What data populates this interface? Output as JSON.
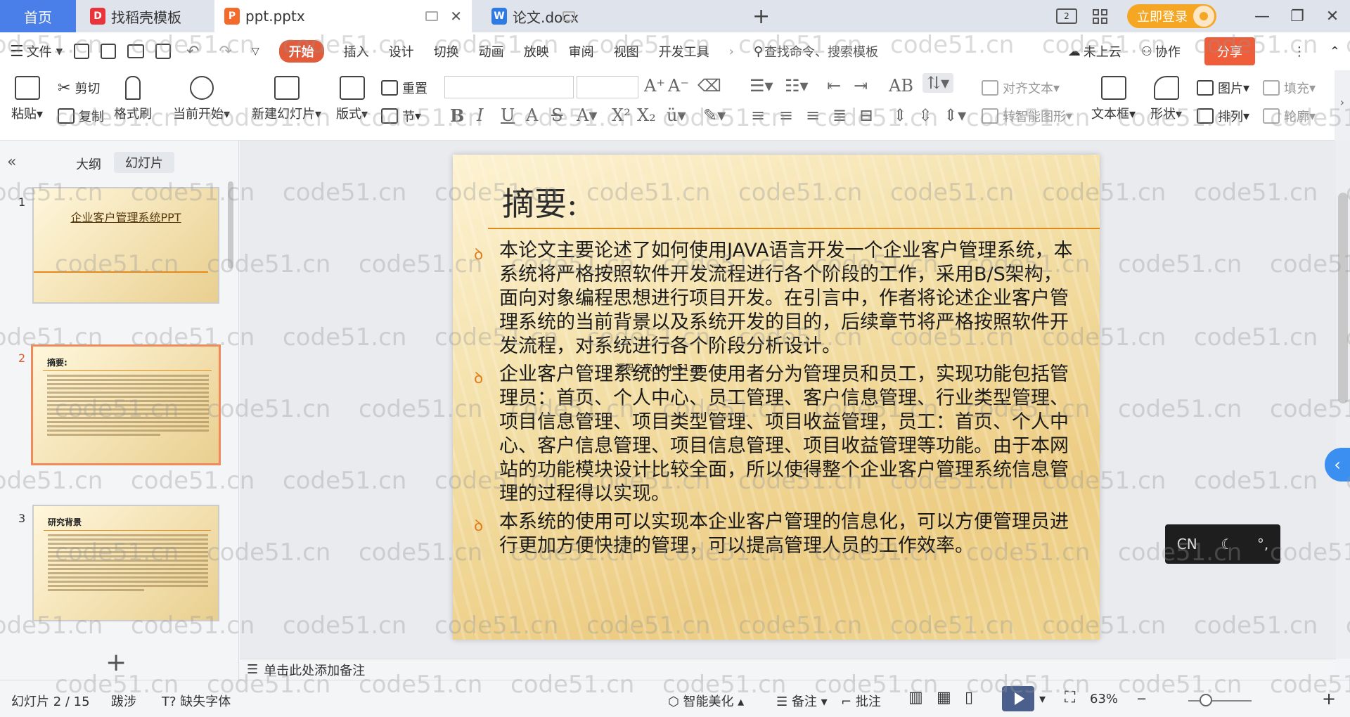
{
  "tabs": {
    "home": "首页",
    "template": "找稻壳模板",
    "ppt": "ppt.pptx",
    "doc": "论文.docx",
    "new": "+"
  },
  "window": {
    "login": "立即登录",
    "min": "—",
    "max": "❐",
    "close": "✕"
  },
  "menu": {
    "file": "文件",
    "start": "开始",
    "insert": "插入",
    "design": "设计",
    "switch": "切换",
    "animate": "动画",
    "play": "放映",
    "review": "审阅",
    "view": "视图",
    "dev": "开发工具",
    "search": "查找命令、搜索模板",
    "cloud": "未上云",
    "collab": "协作",
    "share": "分享"
  },
  "ribbon": {
    "paste": "粘贴",
    "cut": "剪切",
    "copy": "复制",
    "format_brush": "格式刷",
    "from_current": "当前开始",
    "new_slide": "新建幻灯片",
    "layout": "版式",
    "reset": "重置",
    "section": "节",
    "align_text": "对齐文本",
    "smart_shape": "转智能图形",
    "textbox": "文本框",
    "shape": "形状",
    "picture": "图片",
    "arrange": "排列",
    "fill": "填充",
    "outline": "轮廓"
  },
  "panel": {
    "outline": "大纲",
    "slides": "幻灯片",
    "collapse": "«",
    "add": "+"
  },
  "thumbs": [
    {
      "num": "1",
      "title": "企业客户管理系统PPT"
    },
    {
      "num": "2",
      "title": "摘要:"
    },
    {
      "num": "3",
      "title": "研究背景"
    }
  ],
  "slide": {
    "title": "摘要:",
    "bullets": [
      "本论文主要论述了如何使用JAVA语言开发一个企业客户管理系统，本系统将严格按照软件开发流程进行各个阶段的工作，采用B/S架构，面向对象编程思想进行项目开发。在引言中，作者将论述企业客户管理系统的当前背景以及系统开发的目的，后续章节将严格按照软件开发流程，对系统进行各个阶段分析设计。",
      "企业客户管理系统的主要使用者分为管理员和员工，实现功能包括管理员：首页、个人中心、员工管理、客户信息管理、行业类型管理、项目信息管理、项目类型管理、项目收益管理，员工：首页、个人中心、客户信息管理、项目信息管理、项目收益管理等功能。由于本网站的功能模块设计比较全面，所以使得整个企业客户管理系统信息管理的过程得以实现。",
      "本系统的使用可以实现本企业客户管理的信息化，可以方便管理员进行更加方便快捷的管理，可以提高管理人员的工作效率。"
    ],
    "overlay": "源码之家 code51.cn"
  },
  "notes": "单击此处添加备注",
  "status": {
    "slide_pos": "幻灯片 2 / 15",
    "theme": "跋涉",
    "missing_font": "缺失字体",
    "beautify": "智能美化",
    "notes": "备注",
    "comment": "批注",
    "zoom": "63%",
    "minus": "−",
    "plus": "+"
  },
  "ime": {
    "lang": "CN",
    "moon": "☾",
    "punct": "°,"
  },
  "watermark": "code51.cn"
}
